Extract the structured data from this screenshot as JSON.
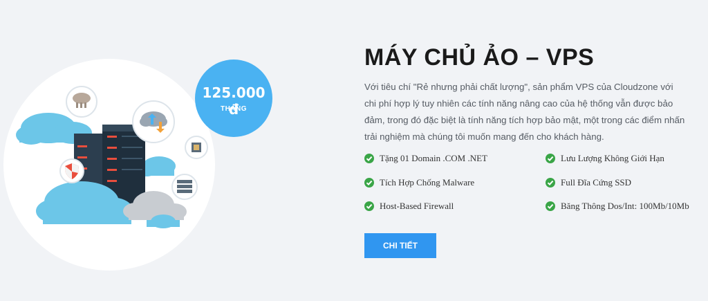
{
  "price": {
    "amount": "125.000 đ",
    "unit": "THÁNG"
  },
  "title": "MÁY CHỦ ẢO – VPS",
  "description": "Với tiêu chí \"Rẻ nhưng phải chất lượng\", sản phẩm VPS của Cloudzone với chi phí hợp lý tuy nhiên các tính năng nâng cao của hệ thống vẫn được bảo đảm, trong đó đặc biệt là tính năng tích hợp bảo mật, một trong các điểm nhấn trải nghiệm mà chúng tôi muốn mang đến cho khách hàng.",
  "features": [
    "Tặng 01 Domain .COM .NET",
    "Lưu Lượng Không Giới Hạn",
    "Tích Hợp Chống Malware",
    "Full Đĩa Cứng SSD",
    "Host-Based Firewall",
    "Băng Thông Dos/Int: 100Mb/10Mb"
  ],
  "button_label": "CHI TIẾT",
  "colors": {
    "accent": "#3096f0",
    "badge": "#4ab2f2",
    "check": "#3aa547",
    "cloud_blue": "#6cc6e8"
  }
}
